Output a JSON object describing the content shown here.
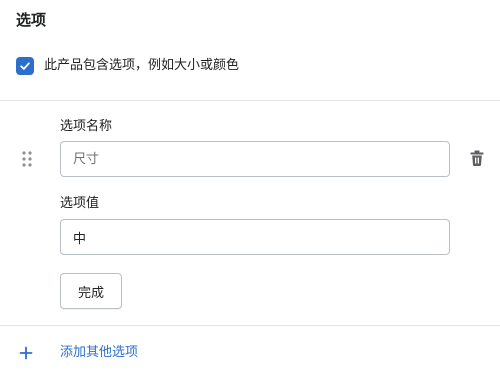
{
  "section": {
    "title": "选项"
  },
  "has_options": {
    "checked": true,
    "label": "此产品包含选项，例如大小或颜色"
  },
  "option": {
    "name_label": "选项名称",
    "name_placeholder": "尺寸",
    "name_value": "",
    "values_label": "选项值",
    "value_placeholder": "",
    "value_value": "中",
    "done_label": "完成"
  },
  "add_option": {
    "label": "添加其他选项"
  },
  "colors": {
    "accent": "#2c6ecb",
    "text": "#202223",
    "border": "#babfc3",
    "divider": "#e1e3e5",
    "icon": "#5c5f62",
    "handle": "#8c9196"
  },
  "icons": {
    "checkbox": "checkmark-icon",
    "drag": "drag-handle-icon",
    "delete": "trash-icon",
    "add": "plus-icon"
  }
}
